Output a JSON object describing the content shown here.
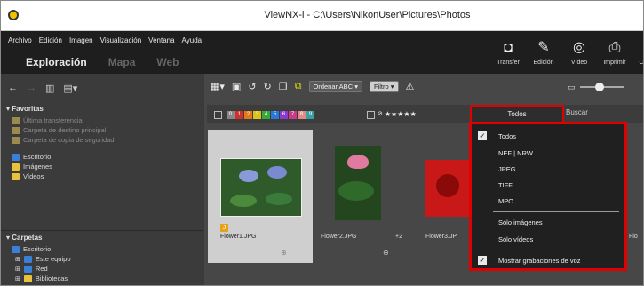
{
  "window": {
    "title": "ViewNX-i - C:\\Users\\NikonUser\\Pictures\\Photos"
  },
  "menu": [
    "Archivo",
    "Edición",
    "Imagen",
    "Visualización",
    "Ventana",
    "Ayuda"
  ],
  "modes": [
    {
      "label": "Exploración",
      "active": true
    },
    {
      "label": "Mapa",
      "active": false
    },
    {
      "label": "Web",
      "active": false
    }
  ],
  "tools": [
    {
      "label": "Transfer",
      "icon": "camera-transfer-icon"
    },
    {
      "label": "Edición",
      "icon": "edit-icon"
    },
    {
      "label": "Vídeo",
      "icon": "video-icon"
    },
    {
      "label": "Imprimir",
      "icon": "print-icon"
    },
    {
      "label": "Co",
      "icon": "more-icon"
    }
  ],
  "favorites": {
    "header": "Favoritas",
    "items": [
      {
        "label": "Última transferencia",
        "dim": true
      },
      {
        "label": "Carpeta de destino principal",
        "dim": true
      },
      {
        "label": "Carpeta de copia de seguridad",
        "dim": true
      },
      {
        "label": "Escritorio",
        "dim": false
      },
      {
        "label": "Imágenes",
        "dim": false
      },
      {
        "label": "Vídeos",
        "dim": false
      }
    ]
  },
  "folders": {
    "header": "Carpetas",
    "items": [
      {
        "label": "Escritorio"
      },
      {
        "label": "Este equipo"
      },
      {
        "label": "Red"
      },
      {
        "label": "Bibliotecas"
      }
    ]
  },
  "toolbar": {
    "sort_label": "Ordenar ABC",
    "filter_label": "Filtro"
  },
  "color_labels": [
    "0",
    "1",
    "2",
    "3",
    "4",
    "5",
    "6",
    "7",
    "8",
    "9"
  ],
  "rating_stars": "★★★★★",
  "tabs": {
    "all": "Todos",
    "search": "Buscar"
  },
  "thumbnails": [
    {
      "name": "Flower1.JPG",
      "selected": true
    },
    {
      "name": "Flower2.JPG",
      "badge": "+2",
      "selected": false
    },
    {
      "name": "Flower3.JP",
      "selected": false
    },
    {
      "name": "Flo",
      "selected": false
    }
  ],
  "dropdown": {
    "items": [
      {
        "label": "Todos",
        "checked": true
      },
      {
        "label": "NEF | NRW",
        "checked": false
      },
      {
        "label": "JPEG",
        "checked": false
      },
      {
        "label": "TIFF",
        "checked": false
      },
      {
        "label": "MPO",
        "checked": false
      },
      {
        "label": "Sólo imágenes",
        "checked": false
      },
      {
        "label": "Sólo vídeos",
        "checked": false
      },
      {
        "label": "Mostrar grabaciones de voz",
        "checked": true
      }
    ]
  },
  "colors": {
    "highlight": "#e00000",
    "dark_bg": "#1e1e1e",
    "panel_bg": "#3b3b3b"
  }
}
